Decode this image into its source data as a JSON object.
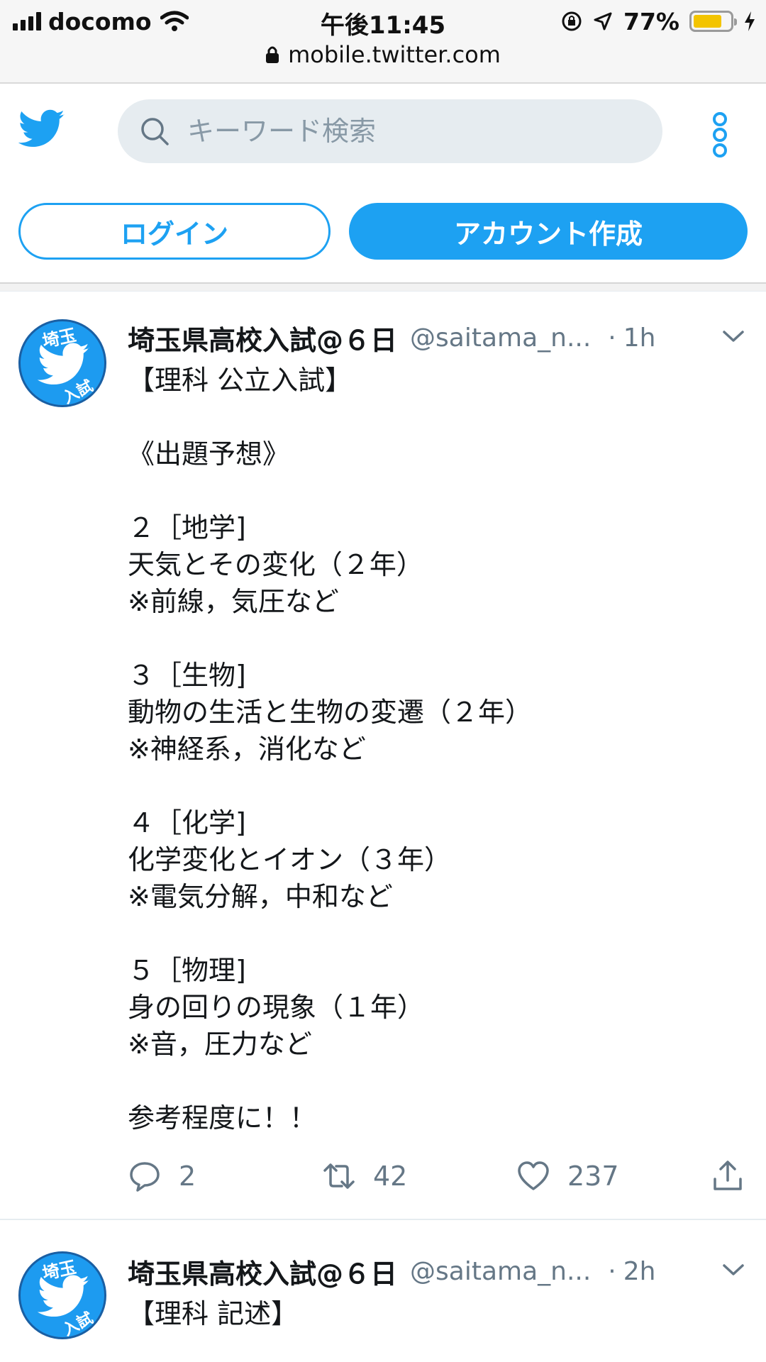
{
  "status_bar": {
    "carrier": "docomo",
    "time": "午後11:45",
    "battery_pct": "77%",
    "battery_level": 0.77,
    "url": "mobile.twitter.com"
  },
  "header": {
    "search_placeholder": "キーワード検索",
    "login_label": "ログイン",
    "signup_label": "アカウント作成"
  },
  "colors": {
    "accent": "#1da1f2",
    "text": "#14171a",
    "muted": "#657786"
  },
  "tweets": [
    {
      "name": "埼玉県高校入試@６日",
      "handle": "@saitama_n...",
      "dot": "·",
      "time": "1h",
      "avatar_text_top": "埼玉",
      "avatar_text_bottom": "入試",
      "text": "【理科 公立入試】\n\n《出題予想》\n\n２［地学]\n天気とその変化（２年）\n※前線，気圧など\n\n３［生物]\n動物の生活と生物の変遷（２年）\n※神経系，消化など\n\n４［化学]\n化学変化とイオン（３年）\n※電気分解，中和など\n\n５［物理]\n身の回りの現象（１年）\n※音，圧力など\n\n参考程度に！！",
      "replies": "2",
      "retweets": "42",
      "likes": "237"
    },
    {
      "name": "埼玉県高校入試@６日",
      "handle": "@saitama_n...",
      "dot": "·",
      "time": "2h",
      "avatar_text_top": "埼玉",
      "avatar_text_bottom": "入試",
      "text": "【理科 記述】"
    }
  ]
}
